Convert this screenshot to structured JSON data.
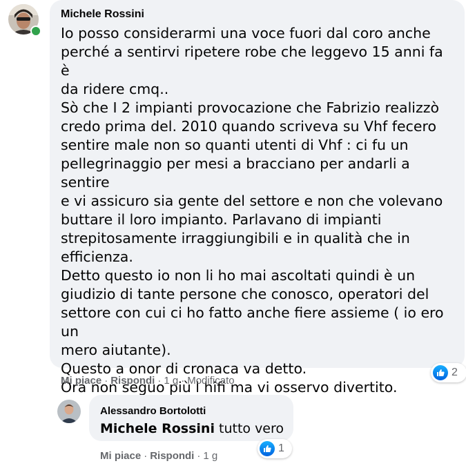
{
  "comment1": {
    "author": "Michele Rossini",
    "text": "Io posso considerarmi una voce fuori dal coro anche\nperché a sentirvi ripetere robe che leggevo 15 anni fa è\nda ridere cmq..\nSò che I 2 impianti provocazione che Fabrizio realizzò\ncredo prima del. 2010 quando scriveva su Vhf fecero\nsentire male non so quanti utenti di Vhf : ci fu un\npellegrinaggio per mesi a bracciano per andarli a sentire\ne vi assicuro sia gente del settore e non che volevano\nbuttare il loro impianto. Parlavano di impianti\nstrepitosamente irraggiungibili e in qualità che in\nefficienza.\nDetto questo io non li ho mai ascoltati quindi è un\ngiudizio di tante persone che conosco, operatori del\nsettore con cui ci ho fatto anche fiere assieme ( io ero un\nmero aiutante).\nQuesto a onor di cronaca va detto.\nOra non seguo più l hifi ma vi osservo divertito.",
    "like": "Mi piace",
    "reply": "Rispondi",
    "time": "1 g",
    "edited": "Modificato",
    "reaction_count": "2",
    "online": true
  },
  "comment2": {
    "author": "Alessandro Bortolotti",
    "mention": "Michele Rossini",
    "text": " tutto vero",
    "like": "Mi piace",
    "reply": "Rispondi",
    "time": "1 g",
    "reaction_count": "1"
  },
  "icons": {
    "reaction": "like-thumb-icon",
    "online": "online-status-dot"
  },
  "colors": {
    "bubble": "#f0f2f5",
    "meta": "#65676b",
    "like_blue": "#1877f2",
    "online_green": "#31a24c"
  },
  "separator": "·"
}
